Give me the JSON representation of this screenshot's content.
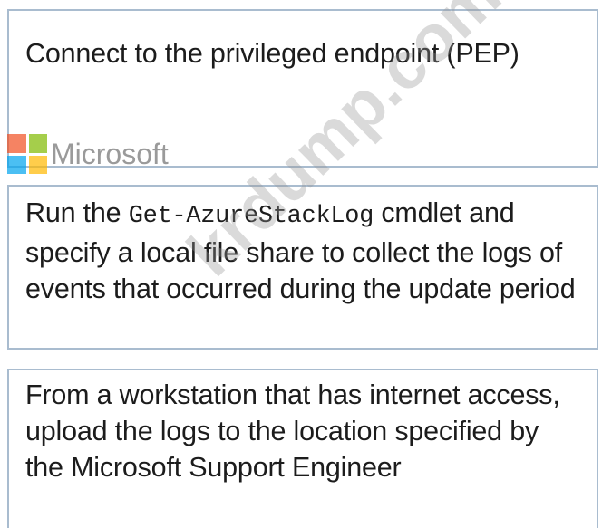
{
  "steps": [
    {
      "text": "Connect to the privileged endpoint (PEP)"
    },
    {
      "prefix": "Run the ",
      "command": "Get-AzureStackLog",
      "suffix": " cmdlet and specify a local file share to collect the logs of events that occurred during the update period"
    },
    {
      "text": "From a workstation that has internet access, upload the logs to the location specified by the Microsoft Support Engineer"
    }
  ],
  "overlay": {
    "logo_text": "Microsoft",
    "logo_colors": [
      "#f25022",
      "#7fba00",
      "#00a4ef",
      "#ffb900"
    ],
    "watermark": "krdump.com"
  }
}
